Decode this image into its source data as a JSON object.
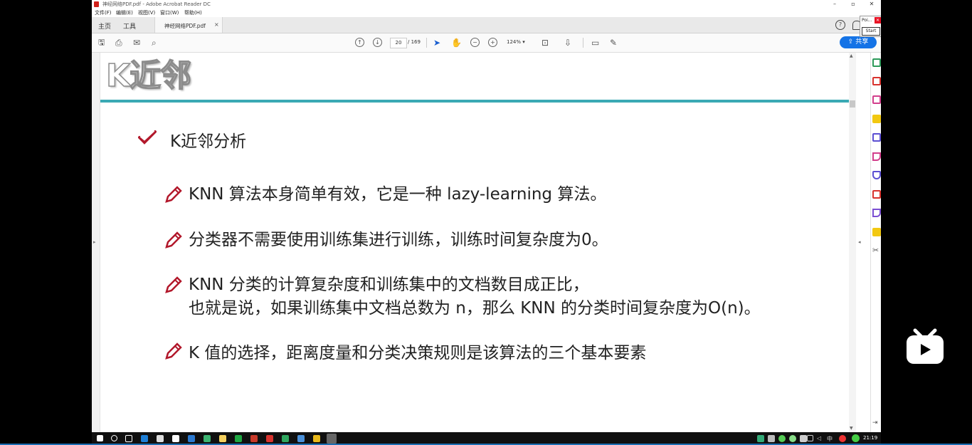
{
  "window": {
    "title": "神经网络PDF.pdf - Adobe Acrobat Reader DC",
    "menu": [
      "文件(F)",
      "编辑(E)",
      "视图(V)",
      "窗口(W)",
      "帮助(H)"
    ]
  },
  "tabs": {
    "home": "主页",
    "tools": "工具",
    "document": "神经网络PDF.pdf",
    "close": "×"
  },
  "toolbar": {
    "page_current": "20",
    "page_total": "/ 169",
    "zoom": "124%",
    "share_label": "共享"
  },
  "popup": {
    "label": "Poi...",
    "start": "Start"
  },
  "document": {
    "heading": "K近邻",
    "section_title": "K近邻分析",
    "bullets": [
      "KNN 算法本身简单有效，它是一种 lazy-learning 算法。",
      "分类器不需要使用训练集进行训练，训练时间复杂度为0。",
      "KNN 分类的计算复杂度和训练集中的文档数目成正比，",
      "也就是说，如果训练集中文档总数为 n，那么 KNN 的分类时间复杂度为O(n)。",
      "K 值的选择，距离度量和分类决策规则是该算法的三个基本要素"
    ]
  },
  "taskbar": {
    "ime": "中",
    "clock": "21:19"
  },
  "colors": {
    "accent_line": "#3aa9b4",
    "check": "#b2182b",
    "share": "#1473e6"
  }
}
